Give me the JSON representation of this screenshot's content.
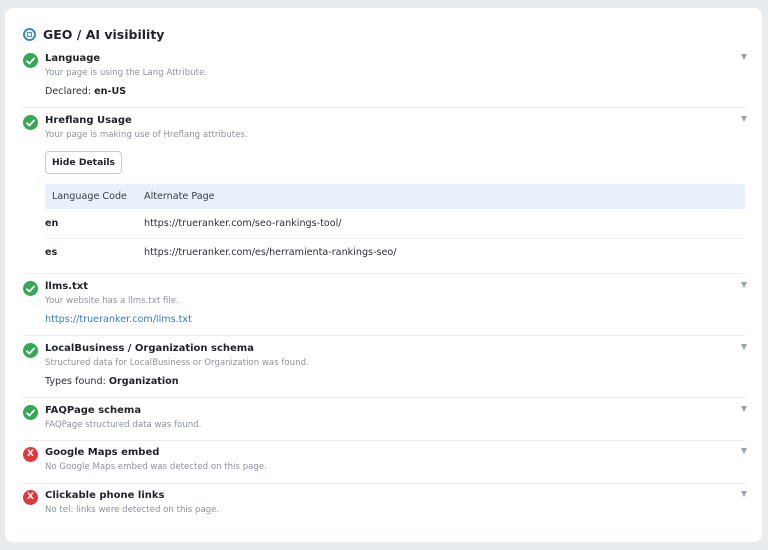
{
  "header": {
    "title": "GEO / AI visibility",
    "icon": "target-icon"
  },
  "colors": {
    "ok": "#35a853",
    "fail": "#e0383b",
    "link": "#3a78c9",
    "table_header": "#e7f0fb"
  },
  "items": [
    {
      "status": "pass",
      "title": "Language",
      "desc": "Your page is using the Lang Attribute.",
      "extra_label": "Declared:",
      "extra_value": "en-US"
    },
    {
      "status": "pass",
      "title": "Hreflang Usage",
      "desc": "Your page is making use of Hreflang attributes.",
      "button_label": "Hide Details",
      "table": {
        "headers": [
          "Language Code",
          "Alternate Page"
        ],
        "rows": [
          [
            "en",
            "https://trueranker.com/seo-rankings-tool/"
          ],
          [
            "es",
            "https://trueranker.com/es/herramienta-rankings-seo/"
          ]
        ]
      }
    },
    {
      "status": "pass",
      "title": "llms.txt",
      "desc": "Your website has a llms.txt file.",
      "link": "https://trueranker.com/llms.txt"
    },
    {
      "status": "pass",
      "title": "LocalBusiness / Organization schema",
      "desc": "Structured data for LocalBusiness or Organization was found.",
      "extra_label": "Types found:",
      "extra_value": "Organization"
    },
    {
      "status": "pass",
      "title": "FAQPage schema",
      "desc": "FAQPage structured data was found."
    },
    {
      "status": "fail",
      "title": "Google Maps embed",
      "desc": "No Google Maps embed was detected on this page.",
      "fail_mark": "X"
    },
    {
      "status": "fail",
      "title": "Clickable phone links",
      "desc": "No tel: links were detected on this page.",
      "fail_mark": "X"
    }
  ]
}
